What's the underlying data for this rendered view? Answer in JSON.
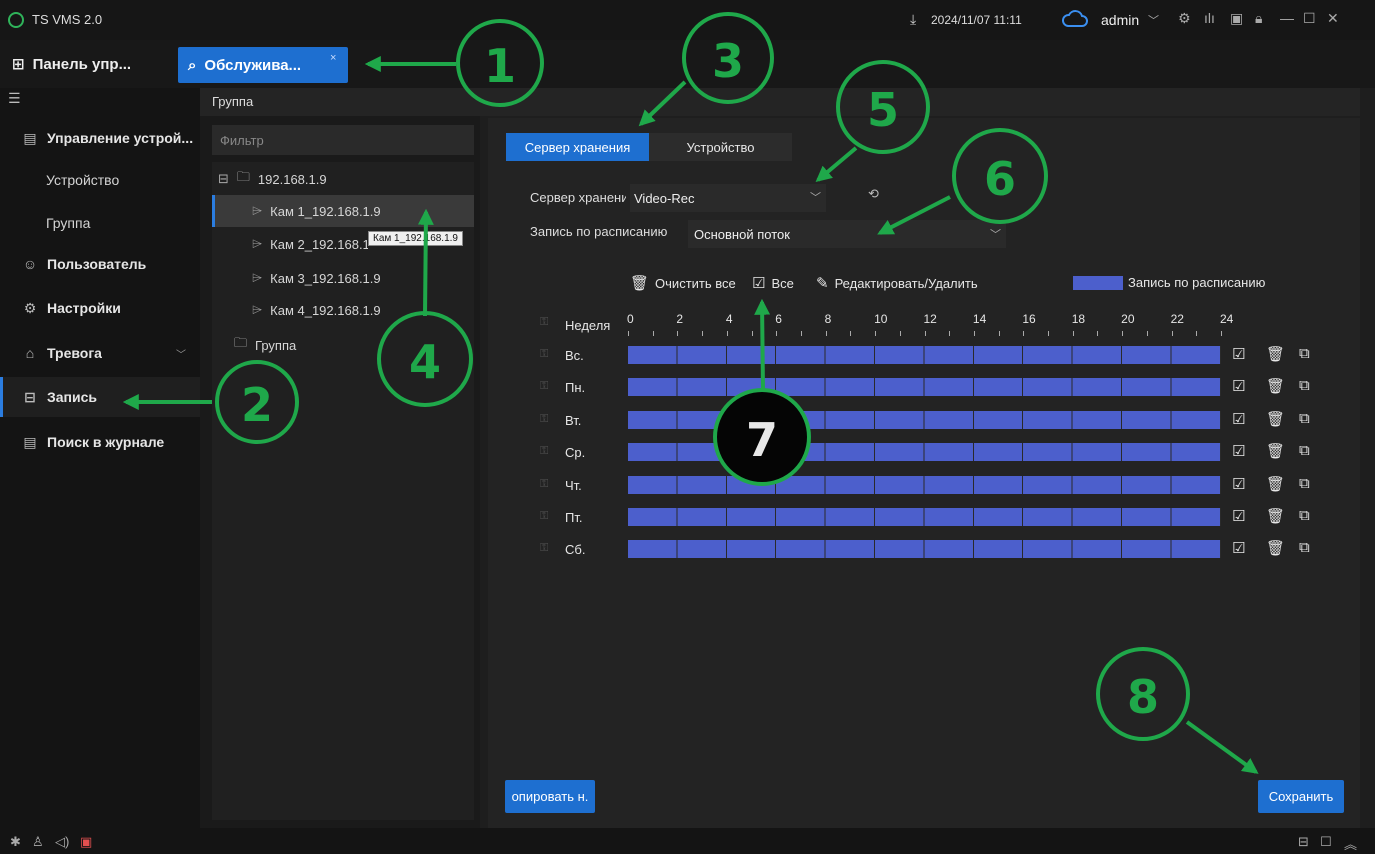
{
  "app": {
    "title": "TS VMS 2.0",
    "datetime": "2024/11/07 11:11",
    "username": "admin"
  },
  "tabs": [
    {
      "label": "Панель упр...",
      "icon": "dashboard-icon"
    },
    {
      "label": "Обслужива...",
      "icon": "maintenance-icon",
      "active": true
    }
  ],
  "sidebar": {
    "items": [
      {
        "label": "Управление устрой...",
        "icon": "device-management-icon"
      },
      {
        "label": "Устройство"
      },
      {
        "label": "Группа"
      },
      {
        "label": "Пользователь",
        "icon": "user-icon"
      },
      {
        "label": "Настройки",
        "icon": "settings-icon"
      },
      {
        "label": "Тревога",
        "icon": "alarm-icon"
      },
      {
        "label": "Запись",
        "icon": "record-icon",
        "active": true
      },
      {
        "label": "Поиск в журнале",
        "icon": "log-icon"
      }
    ]
  },
  "group_panel": {
    "title": "Группа",
    "filter_placeholder": "Фильтр",
    "tree": [
      {
        "label": "192.168.1.9"
      },
      {
        "label": "Кам 1_192.168.1.9",
        "selected": true
      },
      {
        "label": "Кам 2_192.168.1.9"
      },
      {
        "label": "Кам 3_192.168.1.9"
      },
      {
        "label": "Кам 4_192.168.1.9"
      },
      {
        "label": "Группа"
      }
    ],
    "tooltip": "Кам 1_192.168.1.9"
  },
  "record": {
    "tab_storage": "Сервер хранения",
    "tab_device": "Устройство",
    "server_label": "Сервер хранения",
    "server_value": "Video-Rec",
    "schedule_label": "Запись по расписанию",
    "stream_value": "Основной поток",
    "toolbar": {
      "clear_all": "Очистить все",
      "all": "Все",
      "edit_delete": "Редактировать/Удалить"
    },
    "legend": {
      "label": "Запись по расписанию",
      "color": "#4c5fcc"
    },
    "week_label": "Неделя",
    "hours": [
      "0",
      "2",
      "4",
      "6",
      "8",
      "10",
      "12",
      "14",
      "16",
      "18",
      "20",
      "22",
      "24"
    ],
    "days": [
      "Вс.",
      "Пн.",
      "Вт.",
      "Ср.",
      "Чт.",
      "Пт.",
      "Сб."
    ],
    "copy_button": "опировать н.",
    "save_button": "Сохранить"
  },
  "annotations": [
    "1",
    "2",
    "3",
    "4",
    "5",
    "6",
    "7",
    "8"
  ],
  "colors": {
    "accent": "#1e6fd0",
    "annotation": "#1fa84a",
    "schedule_bar": "#4c5fcc"
  }
}
